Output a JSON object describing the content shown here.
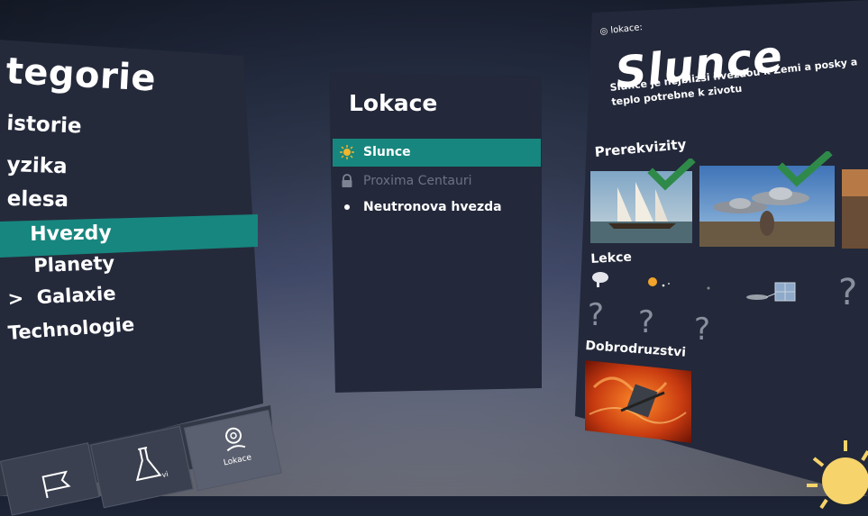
{
  "categories": {
    "title": "tegorie",
    "items": [
      {
        "label": "istorie"
      },
      {
        "label": "yzika"
      },
      {
        "label": "elesa"
      },
      {
        "label": "Hvezdy",
        "selected": true
      },
      {
        "label": "Planety"
      },
      {
        "label": "Galaxie",
        "prefix": ">"
      },
      {
        "label": "Technologie"
      }
    ],
    "tabs": [
      {
        "label": "",
        "icon": "flag-icon"
      },
      {
        "label": "vi",
        "icon": "flask-icon"
      },
      {
        "label": "Lokace",
        "icon": "location-pin-icon",
        "active": true
      }
    ]
  },
  "locations": {
    "title": "Lokace",
    "items": [
      {
        "label": "Slunce",
        "icon": "sun-icon",
        "selected": true
      },
      {
        "label": "Proxima Centauri",
        "icon": "lock-icon",
        "locked": true
      },
      {
        "label": "Neutronova hvezda",
        "icon": "dot-icon"
      }
    ]
  },
  "detail": {
    "location_label": "lokace:",
    "title": "Slunce",
    "description": "Slunce je nejblizsi hvezdou k Zemi a posky a teplo potrebne k zivotu",
    "prerequisites_heading": "Prerekvizity",
    "lessons_heading": "Lekce",
    "adventures_heading": "Dobrodruzstvi"
  },
  "colors": {
    "accent": "#17867e",
    "check": "#2f8a4a",
    "panel": "#23283a"
  }
}
